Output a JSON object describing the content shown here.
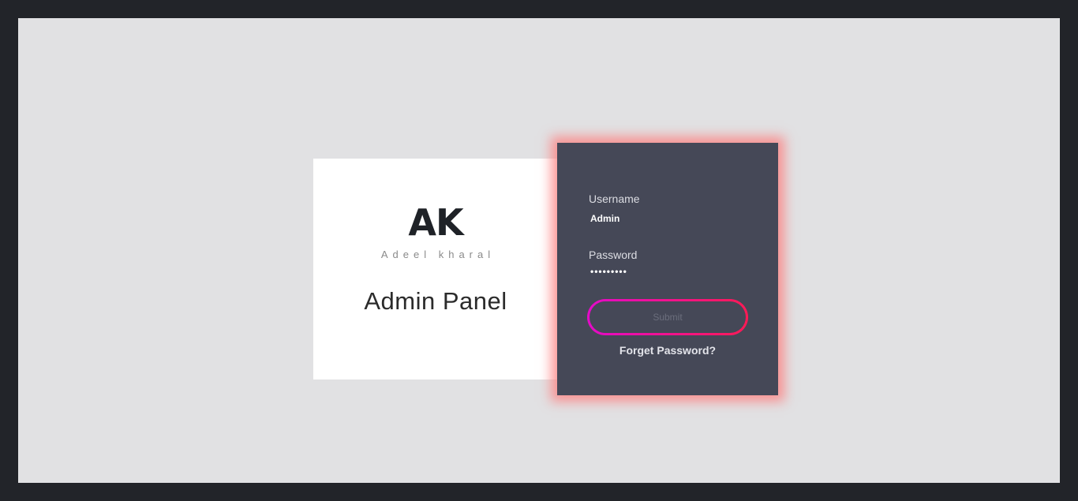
{
  "brand": {
    "logo": "AK",
    "subtitle": "Adeel kharal",
    "panel_title": "Admin Panel"
  },
  "login": {
    "username_label": "Username",
    "username_value": "Admin",
    "password_label": "Password",
    "password_value": "•••••••••",
    "submit_label": "Submit",
    "forget_label": "Forget Password?"
  },
  "colors": {
    "background_outer": "#222429",
    "background_frame": "#e1e1e3",
    "brand_card": "#ffffff",
    "login_card": "#454857",
    "glow": "#ff7878",
    "button_gradient_start": "#e40ac9",
    "button_gradient_end": "#ff1a55"
  }
}
